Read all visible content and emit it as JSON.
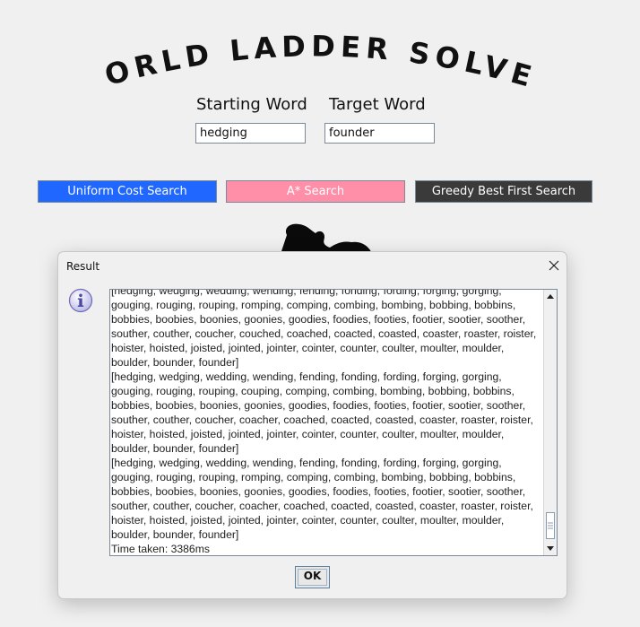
{
  "app": {
    "title": "WORLD LADDER SOLVER"
  },
  "form": {
    "start_label": "Starting Word",
    "target_label": "Target Word",
    "start_value": "hedging",
    "target_value": "founder"
  },
  "buttons": {
    "ucs": "Uniform Cost Search",
    "astar": "A* Search",
    "gbfs": "Greedy Best First Search"
  },
  "colors": {
    "ucs_bg": "#1f67ff",
    "astar_bg": "#ff8fa9",
    "gbfs_bg": "#3a3a3a"
  },
  "dialog": {
    "title": "Result",
    "ok_label": "OK",
    "icon": "info-icon",
    "close_icon": "close-icon",
    "result_text": "[hedging, wedging, wedding, wending, fending, fonding, fording, forging, gorging,\ngouging, rouging, rouping, romping, comping, combing, bombing, bobbing, bobbins,\nbobbies, boobies, boonies, goonies, goodies, foodies, footies, footier, sootier, soother,\nsouther, couther, coucher, couched, coached, coacted, coasted, coaster, roaster, roister,\nhoister, hoisted, joisted, jointed, jointer, cointer, counter, coulter, moulter, moulder,\nboulder, bounder, founder]\n[hedging, wedging, wedding, wending, fending, fonding, fording, forging, gorging,\ngouging, rouging, rouping, couping, comping, combing, bombing, bobbing, bobbins,\nbobbies, boobies, boonies, goonies, goodies, foodies, footies, footier, sootier, soother,\nsouther, couther, coucher, coacher, coached, coacted, coasted, coaster, roaster, roister,\nhoister, hoisted, joisted, jointed, jointer, cointer, counter, coulter, moulter, moulder,\nboulder, bounder, founder]\n[hedging, wedging, wedding, wending, fending, fonding, fording, forging, gorging,\ngouging, rouging, rouping, romping, comping, combing, bombing, bobbing, bobbins,\nbobbies, boobies, boonies, goonies, goodies, foodies, footies, footier, sootier, soother,\nsouther, couther, coucher, coacher, coached, coacted, coasted, coaster, roaster, roister,\nhoister, hoisted, joisted, jointed, jointer, cointer, counter, coulter, moulter, moulder,\nboulder, bounder, founder]\nTime taken: 3386ms"
  }
}
